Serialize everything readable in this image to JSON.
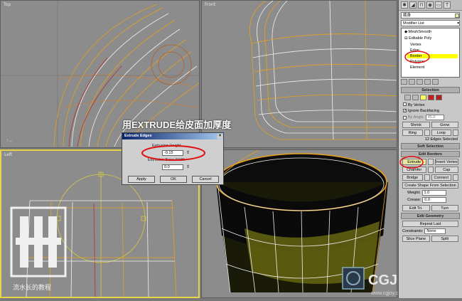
{
  "viewports": {
    "top": {
      "label": "Top"
    },
    "front": {
      "label": "Front"
    },
    "left": {
      "label": "Left"
    },
    "perspective": {
      "label": ""
    }
  },
  "caption": "用EXTRUDE给皮面加厚度",
  "dialog": {
    "title": "Extrude Edges",
    "height_label": "Extrusion Height",
    "height_value": "-0.15",
    "base_width_label": "Extrusion Base Width",
    "base_width_value": "0.0",
    "apply": "Apply",
    "ok": "OK",
    "cancel": "Cancel"
  },
  "panel": {
    "object_name": "瓶身",
    "modifier_list": "Modifier List",
    "stack": [
      "MeshSmooth",
      "Editable Poly",
      "Vertex",
      "Edge",
      "Border",
      "Polygon",
      "Element"
    ],
    "selected_stack_item": "Border",
    "selection": {
      "header": "Selection",
      "by_vertex": "By Vertex",
      "ignore_backfacing": "Ignore Backfacing",
      "by_angle": "By Angle",
      "by_angle_value": "45.0",
      "shrink": "Shrink",
      "grow": "Grow",
      "ring": "Ring",
      "loop": "Loop",
      "status": "12 Edges Selected"
    },
    "soft_selection": "Soft Selection",
    "edit_borders": {
      "header": "Edit Borders",
      "extrude": "Extrude",
      "insert_vertex": "Insert Vertex",
      "chamfer": "Chamfer",
      "cap": "Cap",
      "bridge": "Bridge",
      "connect": "Connect",
      "create_shape": "Create Shape From Selection",
      "weight_label": "Weight:",
      "weight_value": "1.0",
      "crease_label": "Crease:",
      "crease_value": "0.0",
      "edit_tri": "Edit Tri.",
      "turn": "Turn"
    },
    "edit_geometry": {
      "header": "Edit Geometry",
      "repeat_last": "Repeat Last",
      "constraints_label": "Constraints:",
      "constraints_value": "None",
      "slice_plane": "Slice Plane",
      "split": "Split"
    }
  },
  "watermarks": {
    "left_text": "流水长的教程",
    "right_logo": "CGJOL",
    "right_url": "www.cgjoy.com"
  },
  "colors": {
    "highlight": "#ffff00",
    "annotation": "#e01010",
    "wire_orange": "#e8a020",
    "wire_white": "#f0f0f0"
  }
}
